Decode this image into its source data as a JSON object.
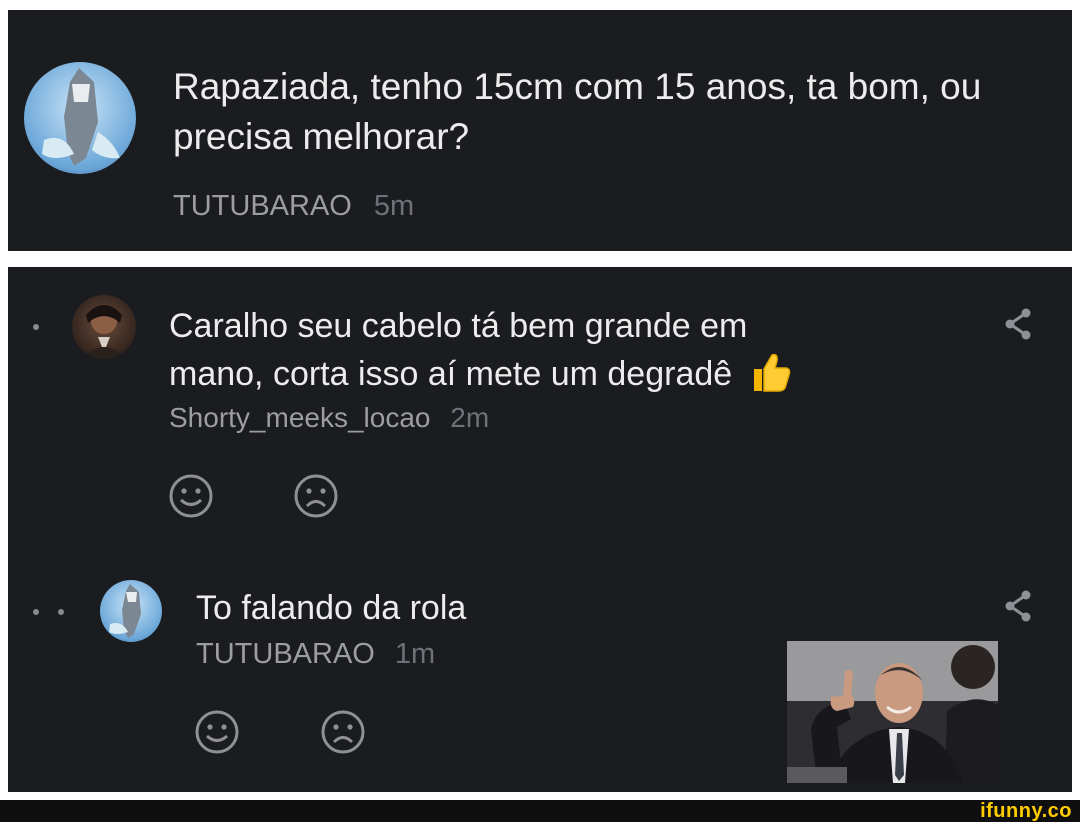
{
  "post": {
    "text": "Rapaziada, tenho 15cm com 15 anos, ta bom, ou precisa melhorar?",
    "author": "TUTUBARAO",
    "time": "5m"
  },
  "comments": [
    {
      "text_line1": "Caralho seu cabelo tá bem grande em",
      "text_line2": "mano, corta isso aí mete um degradê",
      "emoji": "👍",
      "author": "Shorty_meeks_locao",
      "time": "2m"
    },
    {
      "text": "To falando da rola",
      "author": "TUTUBARAO",
      "time": "1m"
    }
  ],
  "icons": [
    "smile-icon",
    "frown-icon",
    "share-icon",
    "thumbs-up-icon"
  ],
  "watermark": "ifunny.co",
  "colors": {
    "background": "#1b1c20",
    "text": "#ececec",
    "meta": "#9c9ca3",
    "watermark": "#ffcc00"
  }
}
